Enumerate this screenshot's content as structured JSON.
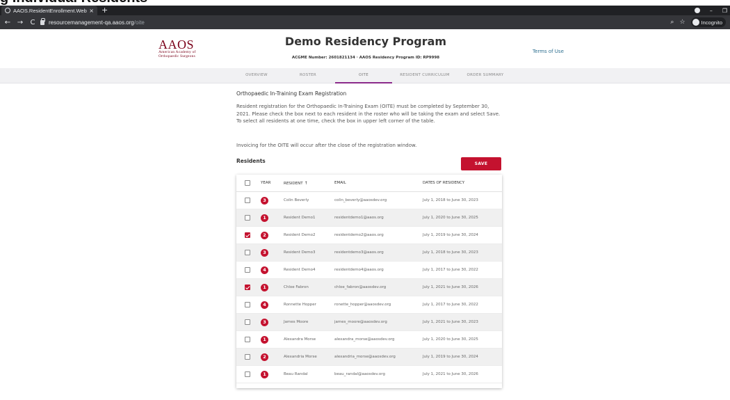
{
  "caption": "g Individual Residents",
  "browser": {
    "tab_title": "AAOS.ResidentEnrollment.Web",
    "tab_close": "×",
    "new_tab": "+",
    "url_host": "resourcemanagement-qa.aaos.org",
    "url_path": "/oite",
    "incognito_label": "Incognito",
    "win_minimize": "–",
    "win_restore": "❐",
    "back": "←",
    "forward": "→",
    "reload": "C",
    "zoom_icon": "⌕",
    "star_icon": "☆"
  },
  "header": {
    "logo_main": "AAOS",
    "logo_sub1": "American Academy of",
    "logo_sub2": "Orthopaedic Surgeons",
    "program_title": "Demo Residency Program",
    "program_meta": "ACGME Number: 2601821134  ·  AAOS Residency Program ID: RP9998",
    "terms_link": "Terms of Use"
  },
  "nav": {
    "items": [
      {
        "label": "Overview"
      },
      {
        "label": "Roster"
      },
      {
        "label": "OITE"
      },
      {
        "label": "Resident Curriculum"
      },
      {
        "label": "Order Summary"
      }
    ],
    "active": "OITE"
  },
  "main": {
    "section_title": "Orthopaedic In-Training Exam Registration",
    "description": "Resident registration for the Orthopaedic In-Training Exam (OITE) must be completed by September 30, 2021. Please check the box next to each resident in the roster who will be taking the exam and select Save. To select all residents at one time, check the box in upper left corner of the table.",
    "invoice_note": "Invoicing for the OITE will occur after the close of the registration window.",
    "residents_label": "Residents",
    "save_label": "Save"
  },
  "table": {
    "headers": {
      "year": "Year",
      "resident": "Resident",
      "sort_icon": "↑",
      "email": "Email",
      "dates": "Dates of Residency"
    },
    "rows": [
      {
        "checked": false,
        "year": "3",
        "name": "Colin Beverly",
        "email": "colin_beverly@aaosdev.org",
        "dates": "July 1, 2018 to June 30, 2023"
      },
      {
        "checked": false,
        "year": "1",
        "name": "Resident Demo1",
        "email": "residentdemo1@aaos.org",
        "dates": "July 1, 2020 to June 30, 2025"
      },
      {
        "checked": true,
        "year": "2",
        "name": "Resident Demo2",
        "email": "residentdemo2@aaos.org",
        "dates": "July 1, 2019 to June 30, 2024"
      },
      {
        "checked": false,
        "year": "3",
        "name": "Resident Demo3",
        "email": "residentdemo3@aaos.org",
        "dates": "July 1, 2018 to June 30, 2023"
      },
      {
        "checked": false,
        "year": "4",
        "name": "Resident Demo4",
        "email": "residentdemo4@aaos.org",
        "dates": "July 1, 2017 to June 30, 2022"
      },
      {
        "checked": true,
        "year": "1",
        "name": "Chloe Fabron",
        "email": "chloe_fabron@aaosdev.org",
        "dates": "July 1, 2021 to June 30, 2026"
      },
      {
        "checked": false,
        "year": "4",
        "name": "Ronnette Hopper",
        "email": "ronette_hopper@aaosdev.org",
        "dates": "July 1, 2017 to June 30, 2022"
      },
      {
        "checked": false,
        "year": "3",
        "name": "James Moore",
        "email": "james_moore@aaosdev.org",
        "dates": "July 1, 2021 to June 30, 2023"
      },
      {
        "checked": false,
        "year": "1",
        "name": "Alexandra Morse",
        "email": "alexandra_morse@aaosdev.org",
        "dates": "July 1, 2020 to June 30, 2025"
      },
      {
        "checked": false,
        "year": "2",
        "name": "Alexandria Morse",
        "email": "alexandria_morse@aaosdev.org",
        "dates": "July 1, 2019 to June 30, 2024"
      },
      {
        "checked": false,
        "year": "1",
        "name": "Beau Randal",
        "email": "beau_randal@aaosdev.org",
        "dates": "July 1, 2021 to June 30, 2026"
      }
    ]
  },
  "colors": {
    "accent": "#c4122f",
    "nav_active": "#8b2a8a",
    "logo": "#7a0019",
    "link": "#2c6e8f"
  }
}
